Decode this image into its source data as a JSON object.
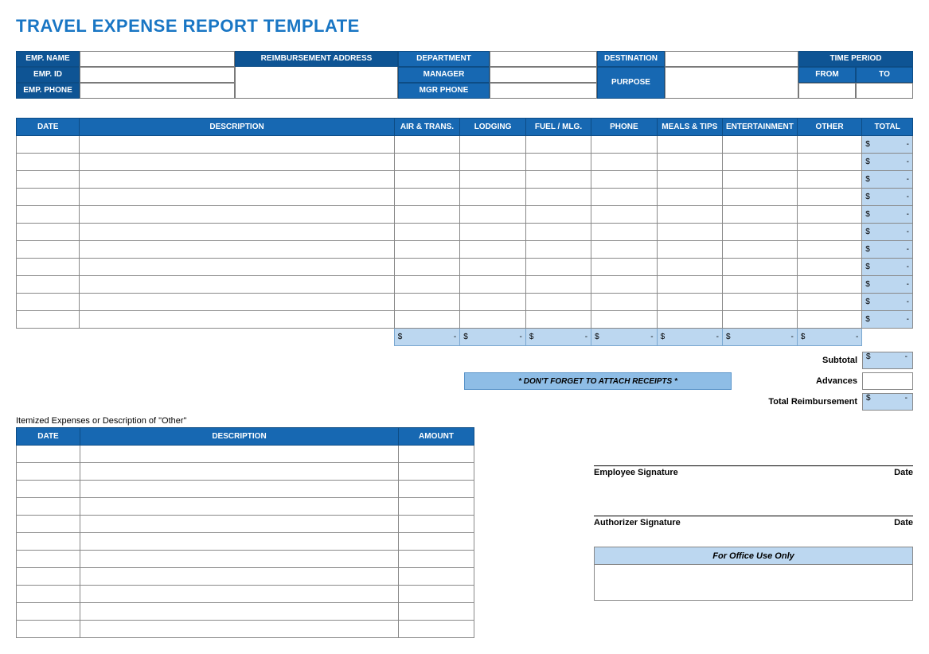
{
  "title": "TRAVEL EXPENSE REPORT TEMPLATE",
  "info": {
    "emp_name": "EMP. NAME",
    "emp_id": "EMP. ID",
    "emp_phone": "EMP. PHONE",
    "reimb_addr": "REIMBURSEMENT ADDRESS",
    "department": "DEPARTMENT",
    "manager": "MANAGER",
    "mgr_phone": "MGR PHONE",
    "destination": "DESTINATION",
    "purpose": "PURPOSE",
    "time_period": "TIME PERIOD",
    "from": "FROM",
    "to": "TO"
  },
  "cols": {
    "date": "DATE",
    "desc": "DESCRIPTION",
    "air": "AIR & TRANS.",
    "lodging": "LODGING",
    "fuel": "FUEL / MLG.",
    "phone": "PHONE",
    "meals": "MEALS & TIPS",
    "ent": "ENTERTAINMENT",
    "other": "OTHER",
    "total": "TOTAL"
  },
  "row_total": {
    "sym": "$",
    "dash": "-"
  },
  "rows_count": 11,
  "subtotals": {
    "subtotal": "Subtotal",
    "advances": "Advances",
    "reimb": "Total Reimbursement"
  },
  "receipts_note": "* DON'T FORGET TO ATTACH RECEIPTS *",
  "itemized": {
    "label": "Itemized Expenses or Description of \"Other\"",
    "date": "DATE",
    "desc": "DESCRIPTION",
    "amt": "AMOUNT",
    "rows_count": 11
  },
  "sig": {
    "emp": "Employee Signature",
    "auth": "Authorizer Signature",
    "date": "Date"
  },
  "office": "For Office Use Only"
}
